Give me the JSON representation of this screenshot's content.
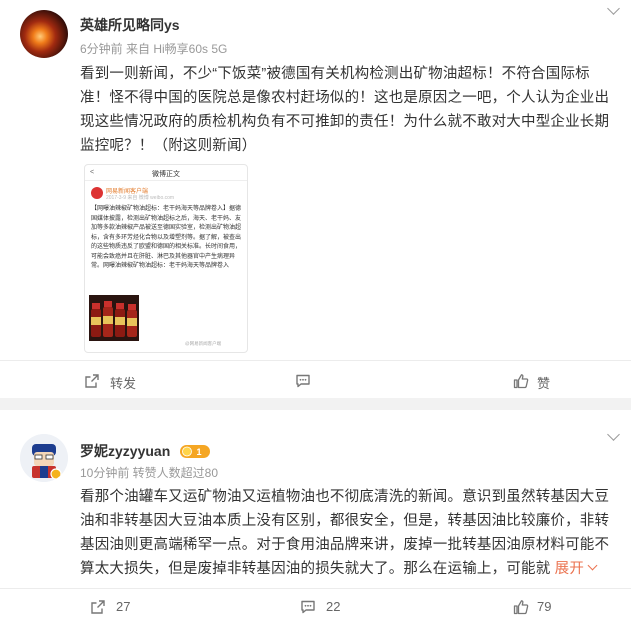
{
  "post": {
    "author": "英雄所见略同ys",
    "meta": "6分钟前  来自 Hi畅享60s 5G",
    "text": "看到一则新闻，不少“下饭菜”被德国有关机构检测出矿物油超标！不符合国际标准！怪不得中国的医院总是像农村赶场似的！这也是原因之一吧，个人认为企业出现这些情况政府的质检机构负有不可推卸的责任！为什么就不敢对大中型企业长期监控呢？！（附这则新闻）",
    "embed": {
      "title": "微博正文",
      "user": "网易新闻客户端",
      "time": "2017-3-9 来自 微博 weibo.com",
      "text": "【网曝油辣椒矿物油超标：老干妈海天等品牌卷入】据德国媒体披露，检测出矿物油超标之后，海天、老干妈、友加等多款油辣椒产品被送至德国实验室，检测出矿物油超标，含有多环芳烃化合物以及增塑剂等。据了解，被查出的这些物质违反了欧盟和德国的相关标准。长时间食用，可能会致癌并且在肝脏、淋巴及其他器官中产生病理异常。网曝油辣椒矿物油超标：老干妈海天等品牌卷入",
      "watermark": "@网易新闻客户端"
    },
    "actions": {
      "repost": "转发",
      "comment": "",
      "like": "赞"
    }
  },
  "comment": {
    "author": "罗妮zyzyyuan",
    "badge_level": "1",
    "meta": "10分钟前  转赞人数超过80",
    "text": "看那个油罐车又运矿物油又运植物油也不彻底清洗的新闻。意识到虽然转基因大豆油和非转基因大豆油本质上没有区别，都很安全，但是，转基因油比较廉价，非转基因油则更高端稀罕一点。对于食用油品牌来讲，废掉一批转基因油原材料可能不算太大损失，但是废掉非转基因油的损失就大了。那么在运输上，可能就",
    "expand": "展开",
    "actions": {
      "repost": "27",
      "comment": "22",
      "like": "79"
    }
  },
  "colors": {
    "accent": "#eb7350",
    "link": "#507daf",
    "badge": "#f5a623"
  }
}
